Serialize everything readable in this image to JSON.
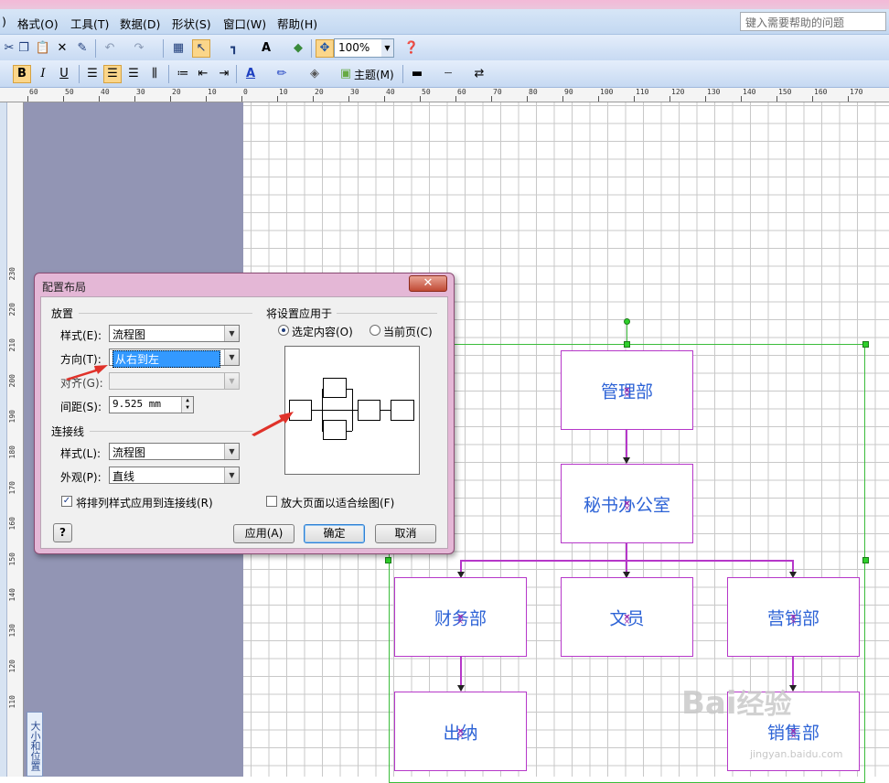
{
  "menubar": {
    "items": [
      "格式(O)",
      "工具(T)",
      "数据(D)",
      "形状(S)",
      "窗口(W)",
      "帮助(H)"
    ],
    "help_placeholder": "键入需要帮助的问题"
  },
  "toolbar": {
    "zoom": "100%",
    "theme_label": "主题(M)",
    "bold": "B",
    "italic": "I",
    "underline": "U"
  },
  "ruler": {
    "h_ticks": [
      "60",
      "50",
      "40",
      "30",
      "20",
      "10",
      "0",
      "10",
      "20",
      "30",
      "40",
      "50",
      "60",
      "70",
      "80",
      "90",
      "100",
      "110",
      "120",
      "130",
      "140",
      "150",
      "160",
      "170"
    ],
    "v_ticks": [
      "230",
      "220",
      "210",
      "200",
      "190",
      "180",
      "170",
      "160",
      "150",
      "140",
      "130",
      "120",
      "110"
    ]
  },
  "side_panel": {
    "tab_label": "大小和位置"
  },
  "dialog": {
    "title": "配置布局",
    "close_label": "✕",
    "section_placement": "放置",
    "style_label": "样式(E):",
    "style_value": "流程图",
    "direction_label": "方向(T):",
    "direction_value": "从右到左",
    "align_label": "对齐(G):",
    "align_value": "",
    "spacing_label": "间距(S):",
    "spacing_value": "9.525 mm",
    "section_connector": "连接线",
    "conn_style_label": "样式(L):",
    "conn_style_value": "流程图",
    "appearance_label": "外观(P):",
    "appearance_value": "直线",
    "apply_arrange_label": "将排列样式应用到连接线(R)",
    "apply_arrange_checked": true,
    "apply_to_label": "将设置应用于",
    "radio_selection": "选定内容(O)",
    "radio_page": "当前页(C)",
    "enlarge_label": "放大页面以适合绘图(F)",
    "enlarge_checked": false,
    "help_button": "?",
    "apply_button": "应用(A)",
    "ok_button": "确定",
    "cancel_button": "取消"
  },
  "org_chart": {
    "boxes": [
      "管理部",
      "秘书办公室",
      "财务部",
      "文员",
      "营销部",
      "出纳",
      "销售部"
    ]
  },
  "watermark": {
    "text": "Bai经验",
    "url": "jingyan.baidu.com"
  },
  "colors": {
    "box_border": "#b637c9",
    "box_text": "#2d63d6",
    "selection": "#3bbd3b",
    "dialog_frame": "#e4b7d6",
    "arrow": "#e0322a"
  }
}
